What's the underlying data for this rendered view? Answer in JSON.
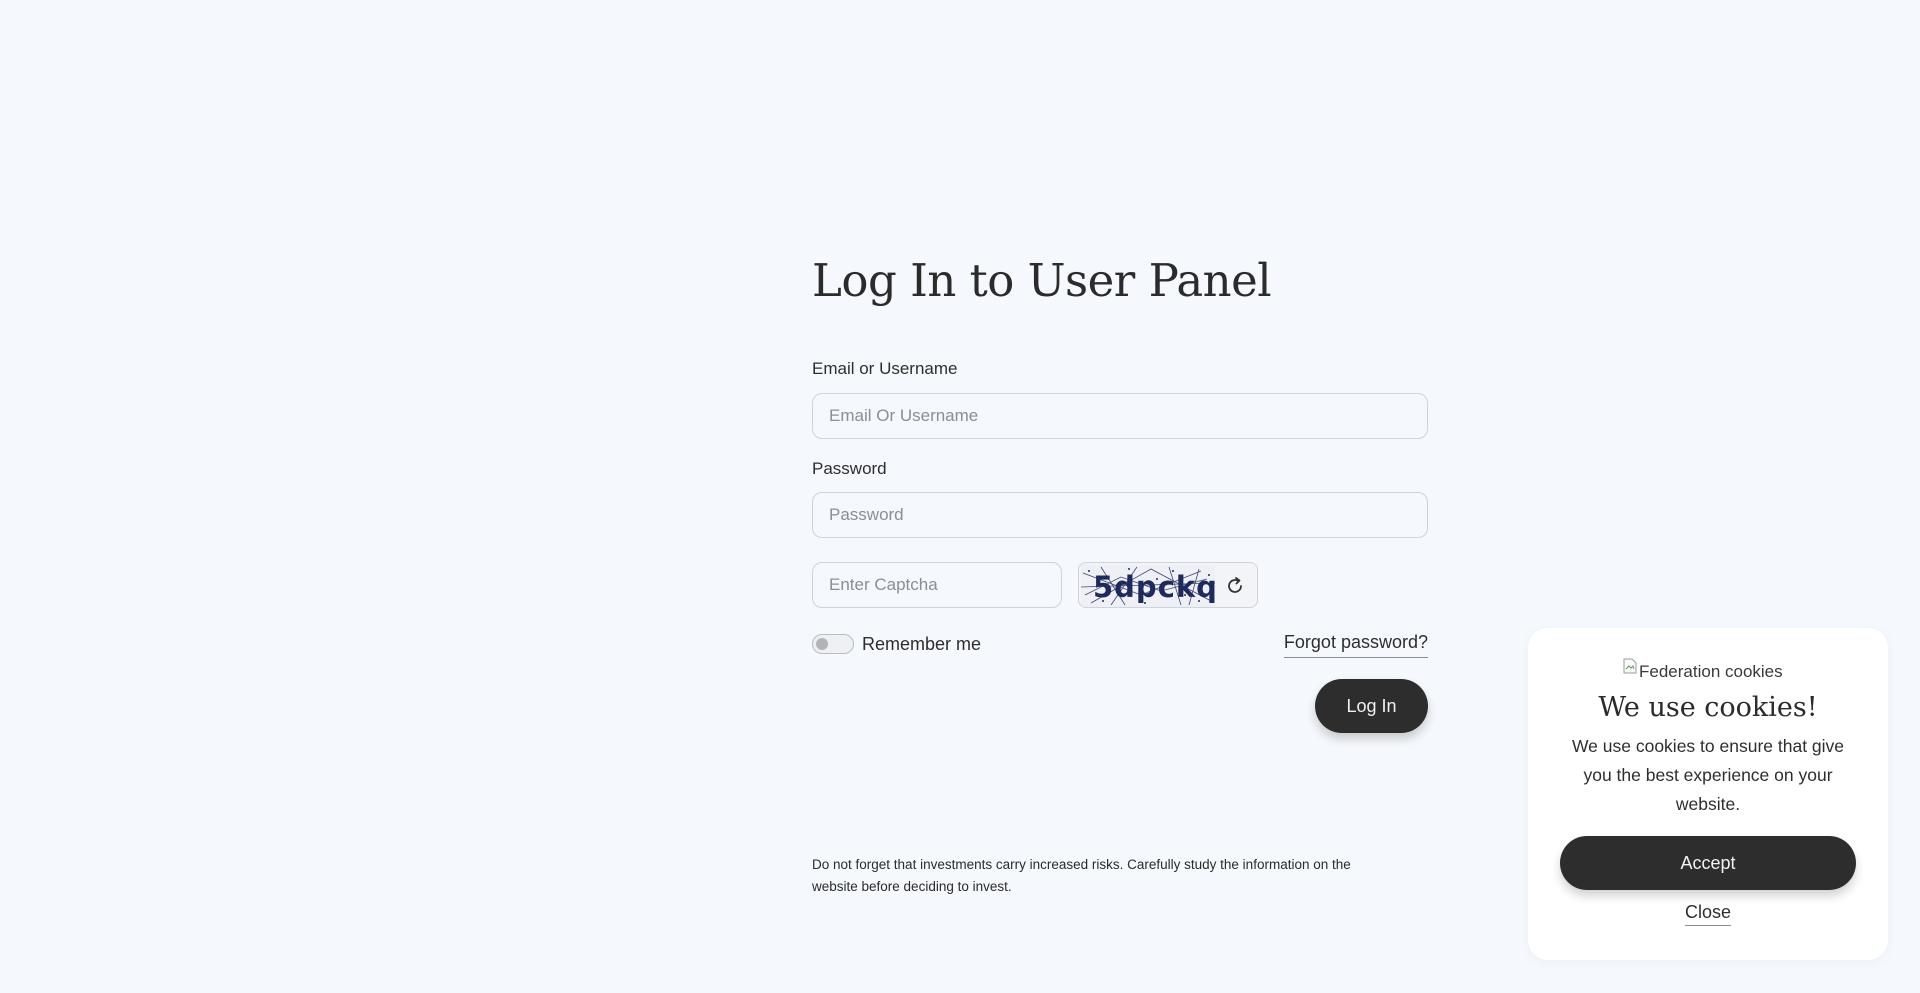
{
  "login": {
    "title": "Log In to User Panel",
    "email_label": "Email or Username",
    "email_placeholder": "Email Or Username",
    "email_value": "",
    "password_label": "Password",
    "password_placeholder": "Password",
    "password_value": "",
    "captcha_placeholder": "Enter Captcha",
    "captcha_value": "",
    "captcha_code": "5dpckq",
    "remember_label": "Remember me",
    "remember_checked": false,
    "forgot_label": "Forgot password?",
    "login_button": "Log In",
    "disclaimer": "Do not forget that investments carry increased risks. Carefully study the information on the website before deciding to invest."
  },
  "cookie": {
    "image_alt": "Federation cookies",
    "title": "We use cookies!",
    "text": "We use cookies to ensure that give you the best experience on your website.",
    "accept_label": "Accept",
    "close_label": "Close"
  },
  "icons": {
    "refresh": "refresh-icon",
    "broken_image": "broken-image-icon"
  },
  "colors": {
    "background": "#f5f8fc",
    "button": "#2d2d2d",
    "captcha_text": "#1f2a5c"
  }
}
